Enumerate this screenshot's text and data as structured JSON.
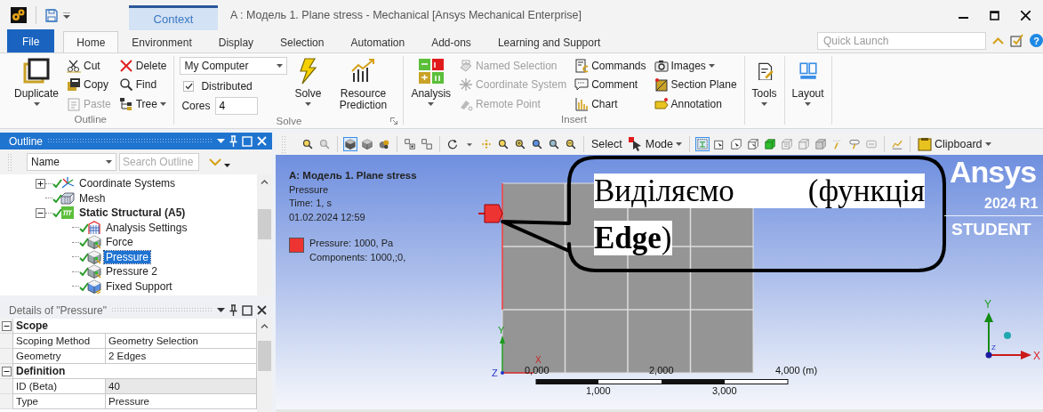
{
  "title_bar": {
    "context": "Context",
    "title": "A : Модель 1. Plane stress - Mechanical [Ansys Mechanical Enterprise]"
  },
  "ribbon_tabs": [
    {
      "label": "File",
      "kind": "file",
      "selected": false
    },
    {
      "label": "Home",
      "kind": "tab",
      "selected": true
    },
    {
      "label": "Environment",
      "kind": "tab",
      "selected": false
    },
    {
      "label": "Display",
      "kind": "tab",
      "selected": false
    },
    {
      "label": "Selection",
      "kind": "tab",
      "selected": false
    },
    {
      "label": "Automation",
      "kind": "tab",
      "selected": false
    },
    {
      "label": "Add-ons",
      "kind": "tab",
      "selected": false
    },
    {
      "label": "Learning and Support",
      "kind": "tab",
      "selected": false
    }
  ],
  "quick_launch": {
    "placeholder": "Quick Launch"
  },
  "help": "?",
  "ribbon_groups": [
    {
      "label": "Outline",
      "launcher": false,
      "columns": [
        [
          {
            "kind": "large",
            "label": "Duplicate",
            "menu": true,
            "disabled": false
          }
        ],
        [
          {
            "kind": "small",
            "label": "Cut",
            "menu": false,
            "disabled": false
          },
          {
            "kind": "small",
            "label": "Copy",
            "menu": false,
            "disabled": false
          },
          {
            "kind": "small",
            "label": "Paste",
            "menu": false,
            "disabled": true
          }
        ],
        [
          {
            "kind": "small",
            "label": "Delete",
            "menu": false,
            "disabled": false
          },
          {
            "kind": "small",
            "label": "Find",
            "menu": false,
            "disabled": false
          },
          {
            "kind": "small",
            "label": "Tree",
            "menu": true,
            "disabled": false
          }
        ]
      ]
    },
    {
      "label": "Solve",
      "launcher": true,
      "columns": [
        [
          {
            "kind": "dropdown",
            "value": "My Computer"
          },
          {
            "kind": "checkbox",
            "label": "Distributed",
            "checked": true
          },
          {
            "kind": "spin",
            "label": "Cores",
            "value": "4"
          }
        ],
        [
          {
            "kind": "large",
            "label": "Solve",
            "menu": true,
            "disabled": false
          }
        ],
        [
          {
            "kind": "large",
            "label": "Resource Prediction",
            "menu": false,
            "disabled": false
          }
        ]
      ]
    },
    {
      "label": "Insert",
      "launcher": false,
      "columns": [
        [
          {
            "kind": "large",
            "label": "Analysis",
            "menu": true,
            "disabled": false
          }
        ],
        [
          {
            "kind": "small",
            "label": "Named Selection",
            "menu": false,
            "disabled": true
          },
          {
            "kind": "small",
            "label": "Coordinate System",
            "menu": false,
            "disabled": true
          },
          {
            "kind": "small",
            "label": "Remote Point",
            "menu": false,
            "disabled": true
          }
        ],
        [
          {
            "kind": "small",
            "label": "Commands",
            "menu": false,
            "disabled": false
          },
          {
            "kind": "small",
            "label": "Comment",
            "menu": false,
            "disabled": false
          },
          {
            "kind": "small",
            "label": "Chart",
            "menu": false,
            "disabled": false
          }
        ],
        [
          {
            "kind": "small",
            "label": "Images",
            "menu": true,
            "disabled": false
          },
          {
            "kind": "small",
            "label": "Section Plane",
            "menu": false,
            "disabled": false
          },
          {
            "kind": "small",
            "label": "Annotation",
            "menu": false,
            "disabled": false
          }
        ]
      ]
    },
    {
      "launcher": false,
      "columns": [
        [
          {
            "kind": "large",
            "label": "Tools",
            "menu": true,
            "disabled": false
          }
        ]
      ]
    },
    {
      "launcher": false,
      "columns": [
        [
          {
            "kind": "large",
            "label": "Layout",
            "menu": true,
            "disabled": false
          }
        ]
      ]
    }
  ],
  "outline": {
    "title": "Outline",
    "filter": "Name",
    "search": {
      "placeholder": "Search Outline"
    },
    "tree": [
      {
        "label": "Coordinate Systems",
        "kind": "coordinate_systems",
        "solved": true,
        "expanded": false,
        "selected": false
      },
      {
        "label": "Mesh",
        "kind": "mesh",
        "solved": true,
        "selected": false
      },
      {
        "label": "Static Structural (A5)",
        "kind": "analysis",
        "solved": true,
        "expanded": true,
        "selected": false,
        "children": [
          {
            "label": "Analysis Settings",
            "kind": "settings",
            "solved": true,
            "selected": false
          },
          {
            "label": "Force",
            "kind": "load",
            "solved": true,
            "selected": false
          },
          {
            "label": "Pressure",
            "kind": "load",
            "solved": true,
            "selected": true
          },
          {
            "label": "Pressure 2",
            "kind": "load",
            "solved": true,
            "selected": false
          },
          {
            "label": "Fixed Support",
            "kind": "support",
            "solved": true,
            "selected": false
          }
        ]
      }
    ]
  },
  "details": {
    "title": "Details of \"Pressure\"",
    "sections": [
      {
        "label": "Scope",
        "expanded": true,
        "rows": [
          {
            "name": "Scoping Method",
            "value": "Geometry Selection",
            "read_only": false
          },
          {
            "name": "Geometry",
            "value": "2 Edges",
            "read_only": false
          }
        ]
      },
      {
        "label": "Definition",
        "expanded": true,
        "rows": [
          {
            "name": "ID (Beta)",
            "value": "40",
            "read_only": true
          },
          {
            "name": "Type",
            "value": "Pressure",
            "read_only": false
          }
        ]
      }
    ]
  },
  "view_toolbar": [
    {
      "kind": "icon",
      "selected": false
    },
    {
      "kind": "icon",
      "selected": false
    },
    {
      "kind": "separator"
    },
    {
      "kind": "icon",
      "selected": true
    },
    {
      "kind": "icon",
      "selected": false
    },
    {
      "kind": "icon",
      "selected": false
    },
    {
      "kind": "separator"
    },
    {
      "kind": "icon",
      "selected": false
    },
    {
      "kind": "icon",
      "selected": false
    },
    {
      "kind": "separator"
    },
    {
      "kind": "icon",
      "selected": false
    },
    {
      "kind": "icon",
      "selected": false
    },
    {
      "kind": "icon",
      "selected": false
    },
    {
      "kind": "icon",
      "selected": false
    },
    {
      "kind": "icon",
      "selected": false
    },
    {
      "kind": "icon",
      "selected": false
    },
    {
      "kind": "icon",
      "selected": false
    },
    {
      "kind": "icon",
      "selected": false
    },
    {
      "kind": "separator"
    },
    {
      "kind": "label",
      "label": "Select"
    },
    {
      "kind": "menu",
      "label": "Mode"
    },
    {
      "kind": "separator"
    },
    {
      "kind": "icon",
      "selected": true
    },
    {
      "kind": "icon",
      "selected": false
    },
    {
      "kind": "icon",
      "selected": false
    },
    {
      "kind": "icon",
      "selected": false
    },
    {
      "kind": "icon",
      "selected": false
    },
    {
      "kind": "icon",
      "selected": false
    },
    {
      "kind": "icon",
      "selected": false
    },
    {
      "kind": "icon",
      "selected": false
    },
    {
      "kind": "icon",
      "selected": false
    },
    {
      "kind": "icon",
      "selected": false
    },
    {
      "kind": "icon",
      "selected": false
    },
    {
      "kind": "separator"
    },
    {
      "kind": "icon",
      "selected": false
    },
    {
      "kind": "separator"
    },
    {
      "kind": "menu",
      "label": "Clipboard"
    }
  ],
  "viewport": {
    "title": "A: Модель 1. Plane stress",
    "lines": [
      "Pressure",
      "Time: 1, s",
      "01.02.2024 12:59"
    ],
    "legend": {
      "color": "#ee3333",
      "lines": [
        "Pressure: 1000, Pa",
        "Components: 1000,;0,"
      ]
    },
    "logo": {
      "name": "Ansys",
      "version": "2024 R1",
      "edition": "STUDENT"
    },
    "model_axes": {
      "x": "X",
      "y": "Y",
      "z": "Z"
    },
    "scale_bar": {
      "top_labels": [
        "0,000",
        "2,000",
        "4,000 (m)"
      ],
      "bottom_labels": [
        "1,000",
        "3,000"
      ]
    },
    "triad": {
      "x": "X",
      "y": "Y",
      "z": "Z"
    },
    "callout": "Виділяємо (функція **Edge**)"
  }
}
